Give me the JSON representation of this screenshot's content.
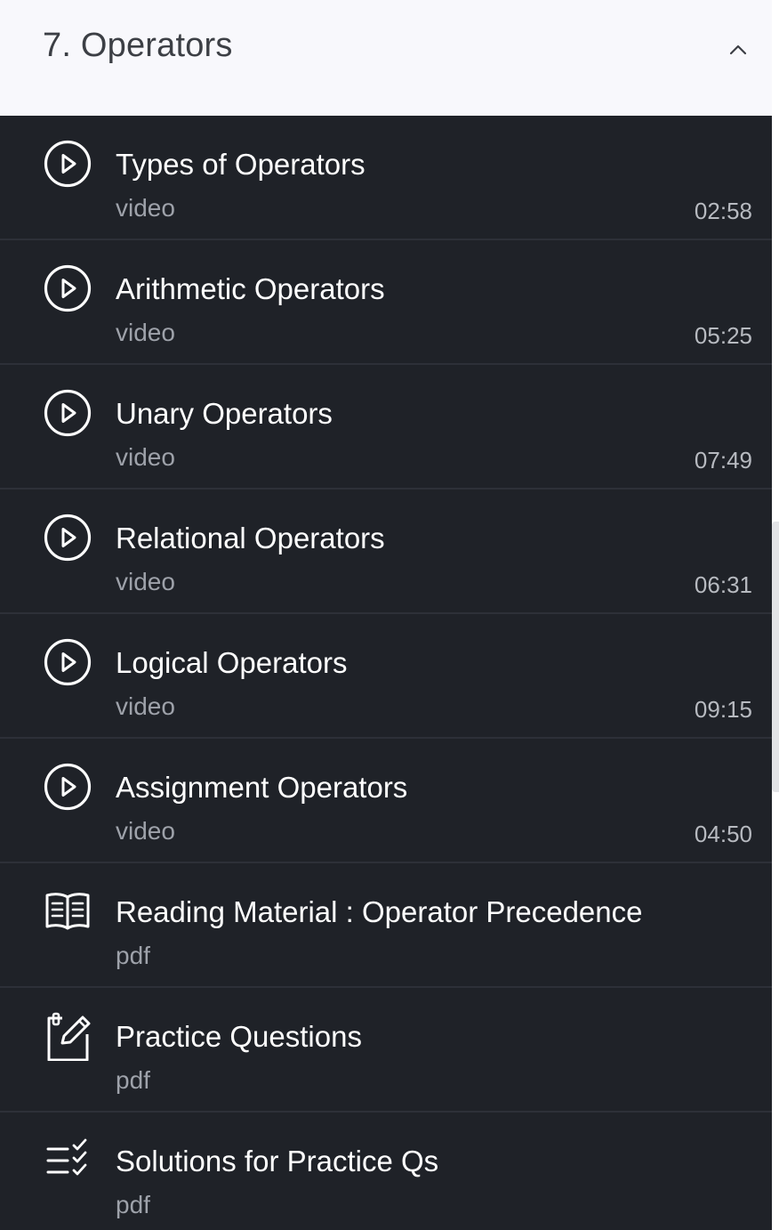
{
  "section": {
    "title": "7. Operators"
  },
  "items": [
    {
      "title": "Types of Operators",
      "type": "video",
      "duration": "02:58",
      "icon": "play-circle-icon"
    },
    {
      "title": "Arithmetic Operators",
      "type": "video",
      "duration": "05:25",
      "icon": "play-circle-icon"
    },
    {
      "title": "Unary Operators",
      "type": "video",
      "duration": "07:49",
      "icon": "play-circle-icon"
    },
    {
      "title": "Relational Operators",
      "type": "video",
      "duration": "06:31",
      "icon": "play-circle-icon"
    },
    {
      "title": "Logical Operators",
      "type": "video",
      "duration": "09:15",
      "icon": "play-circle-icon"
    },
    {
      "title": "Assignment Operators",
      "type": "video",
      "duration": "04:50",
      "icon": "play-circle-icon"
    },
    {
      "title": "Reading Material : Operator Precedence",
      "type": "pdf",
      "icon": "book-open-icon"
    },
    {
      "title": "Practice Questions",
      "type": "pdf",
      "icon": "clipboard-edit-icon"
    },
    {
      "title": "Solutions for Practice Qs",
      "type": "pdf",
      "icon": "checklist-icon"
    }
  ],
  "colors": {
    "header_bg": "#f8f8fc",
    "list_bg": "#1f2228",
    "divider": "#2d3038",
    "title_text": "#ffffff",
    "meta_text": "#9ea2aa"
  }
}
